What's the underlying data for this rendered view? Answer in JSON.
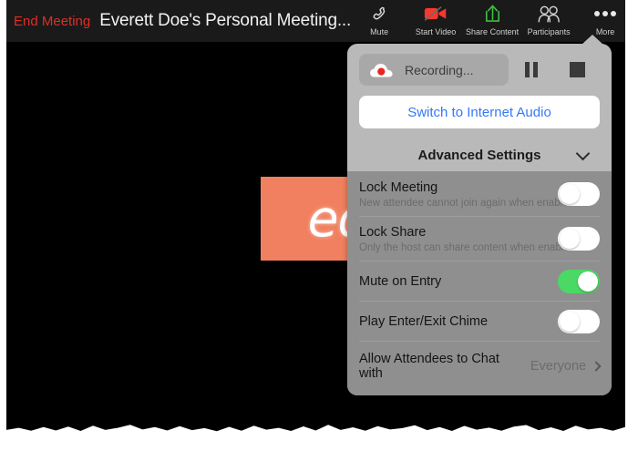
{
  "colors": {
    "end_meeting_red": "#dd2f26",
    "toolbar_bg": "#1a1a1a",
    "popover_bg": "#b9b9b9",
    "settings_bg": "#8f8f8f",
    "link_blue": "#3478f6",
    "toggle_on_green": "#4ad964",
    "logo_orange": "#f0805f",
    "record_red": "#e8251f"
  },
  "toolbar": {
    "end_meeting_label": "End Meeting",
    "meeting_title": "Everett Doe's Personal Meeting...",
    "actions": [
      {
        "label": "Mute",
        "icon": "phone-handset-icon"
      },
      {
        "label": "Start Video",
        "icon": "video-camera-off-icon"
      },
      {
        "label": "Share Content",
        "icon": "share-upload-icon"
      },
      {
        "label": "Participants",
        "icon": "participants-icon"
      },
      {
        "label": "More",
        "icon": "more-dots-icon"
      }
    ]
  },
  "stage": {
    "logo_text": "ed"
  },
  "popover": {
    "recording": {
      "label": "Recording...",
      "icon": "cloud-record-icon",
      "pause_icon": "pause-icon",
      "stop_icon": "stop-icon"
    },
    "internet_audio_label": "Switch to Internet Audio",
    "advanced_settings_label": "Advanced Settings",
    "advanced_chevron_icon": "chevron-down-icon",
    "settings": [
      {
        "title": "Lock Meeting",
        "subtitle": "New attendee cannot join again when enabled",
        "toggle": "off"
      },
      {
        "title": "Lock Share",
        "subtitle": "Only the host can share content when enabled",
        "toggle": "off"
      },
      {
        "title": "Mute on Entry",
        "subtitle": "",
        "toggle": "on"
      },
      {
        "title": "Play Enter/Exit Chime",
        "subtitle": "",
        "toggle": "off"
      }
    ],
    "chat_row": {
      "label": "Allow Attendees to Chat with",
      "value": "Everyone",
      "chevron_icon": "chevron-right-icon"
    }
  }
}
